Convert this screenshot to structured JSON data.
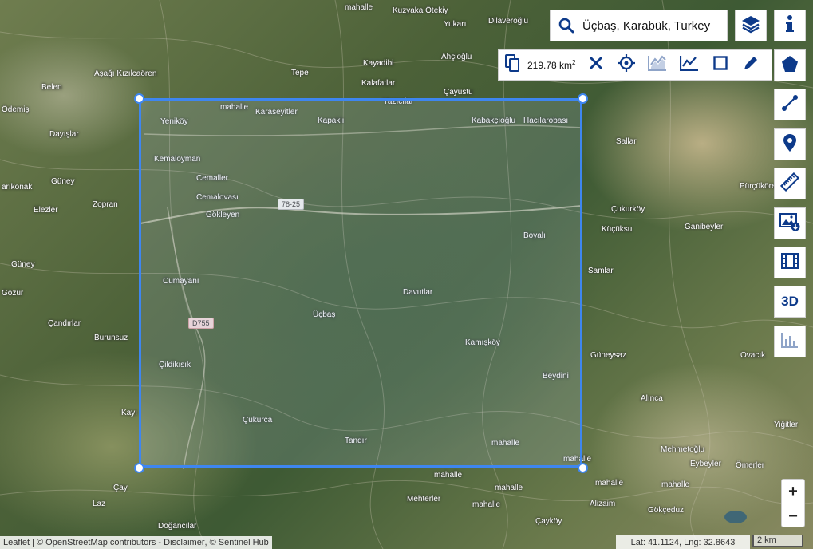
{
  "search": {
    "value": "Üçbaş, Karabük, Turkey"
  },
  "toolbar": {
    "area_value": "219.78 km",
    "area_exp": "2"
  },
  "side_buttons": {
    "three_d_label": "3D"
  },
  "zoom": {
    "in_label": "+",
    "out_label": "−"
  },
  "attribution": {
    "leaflet": "Leaflet",
    "sep1": " | © ",
    "osm": "OpenStreetMap contributors",
    "sep2": " - ",
    "disclaimer": "Disclaimer",
    "sep3": ", © ",
    "sentinel": "Sentinel Hub"
  },
  "coords": {
    "text": "Lat: 41.1124, Lng: 32.8643"
  },
  "scale": {
    "label": "2 km"
  },
  "road_labels": [
    "78-25",
    "D755"
  ],
  "places": [
    "mahalle",
    "Kuzyaka Ötekiy",
    "Yukarı",
    "Dilaveroğlu",
    "Aşağı Kızılcaören",
    "Belen",
    "Kayadibi",
    "Ahçioğlu",
    "Tepe",
    "Kalafatlar",
    "Çayustu",
    "Ödemiş",
    "mahalle",
    "Karaseyitler",
    "Yazıcılar",
    "Yeniköy",
    "Kapaklı",
    "Kabakçıoğlu",
    "Hacılarobası",
    "Dayışlar",
    "Sallar",
    "Kemaloyman",
    "Cemaller",
    "Güney",
    "Pürçükören",
    "Cemalovası",
    "Gökleyen",
    "arıkonak",
    "Zopran",
    "Elezler",
    "Çukurköy",
    "Boyalı",
    "Küçüksu",
    "Ganibeyler",
    "Güney",
    "Samlar",
    "Cumayanı",
    "Gözür",
    "Davutlar",
    "Üçbaş",
    "Çandırlar",
    "Burunsuz",
    "Kamışköy",
    "Güneysaz",
    "Ovacık",
    "Çildikısık",
    "Beydini",
    "Alınca",
    "Yiğitler",
    "Kayı",
    "Çukurca",
    "Tandır",
    "mahalle",
    "mahalle",
    "Mehmetoğlu",
    "Eybeyler",
    "Ömerler",
    "mahalle",
    "mahalle",
    "Çay",
    "mahalle",
    "mahalle",
    "Mehterler",
    "Laz",
    "mahalle",
    "Alizaim",
    "Gökçeduz",
    "Çayköy",
    "Doğancılar"
  ]
}
